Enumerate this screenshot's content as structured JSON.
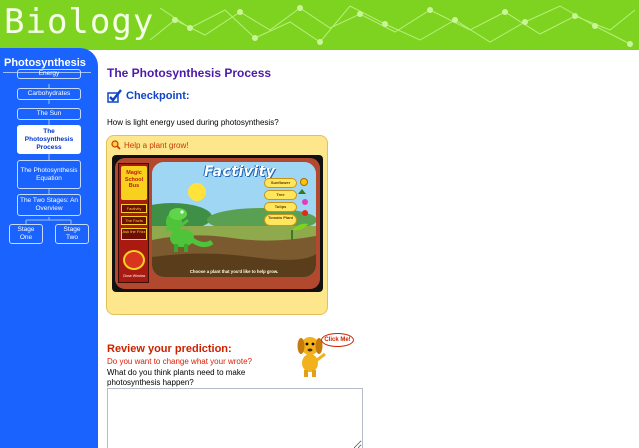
{
  "header": {
    "title": "Biology"
  },
  "sidebar": {
    "title": "Photosynthesis",
    "items": [
      {
        "label": "Energy"
      },
      {
        "label": "Carbohydrates"
      },
      {
        "label": "The Sun"
      },
      {
        "label": "The Photosynthesis Process",
        "active": true
      },
      {
        "label": "The Photosynthesis Equation"
      },
      {
        "label": "The Two Stages: An Overview"
      },
      {
        "label": "Stage One"
      },
      {
        "label": "Stage Two"
      }
    ]
  },
  "main": {
    "title": "The Photosynthesis Process",
    "checkpoint": "Checkpoint:",
    "question": "How is light energy used during photosynthesis?",
    "activity": {
      "help_link": "Help a plant grow!",
      "game": {
        "logo": [
          "Magic",
          "School",
          "Bus"
        ],
        "left_buttons": [
          "Factivity",
          "The Facts",
          "Ask the Frizz"
        ],
        "close_label": "Close Window",
        "scene_title": "Factivity",
        "plant_buttons": [
          "Sunflower",
          "Tree",
          "Tulips",
          "Tomato Plant"
        ],
        "instruction": "Choose a plant that you'd like to help grow."
      }
    },
    "review": {
      "title": "Review your prediction:",
      "subtitle": "Do you want to change what your wrote?",
      "question": "What do you think plants need to make photosynthesis happen?",
      "answer": ""
    },
    "click_me": "Click Me!"
  },
  "colors": {
    "header_green": "#7ed321",
    "sidebar_blue": "#1a63ff",
    "title_purple": "#4a1aa8",
    "review_red": "#cc2200",
    "activity_yellow": "#fde68c"
  }
}
